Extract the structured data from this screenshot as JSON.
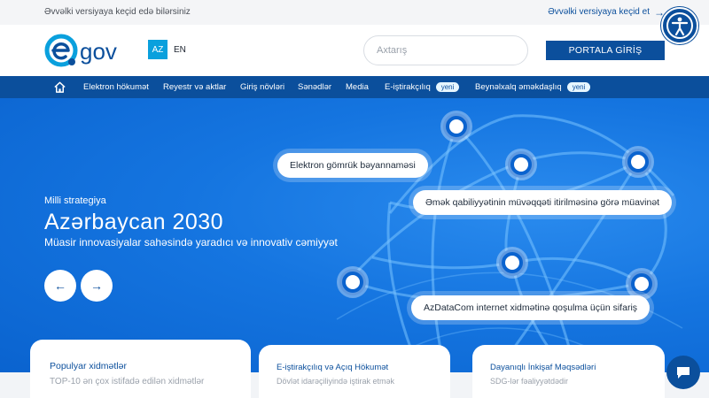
{
  "topbar": {
    "message": "Əvvəlki versiyaya keçid edə bilərsiniz",
    "old_version_link": "Əvvəlki versiyaya keçid et",
    "arrow_icon": "arrow-right-icon"
  },
  "header": {
    "logo_text": "gov",
    "lang_active": "AZ",
    "lang_other": "EN",
    "search_placeholder": "Axtarış",
    "portal_button": "PORTALA GİRİŞ",
    "accessibility_icon": "accessibility-icon"
  },
  "nav": {
    "home_icon": "home-icon",
    "items": [
      {
        "label": "Elektron hökumət"
      },
      {
        "label": "Reyestr və aktlar"
      },
      {
        "label": "Giriş növləri"
      },
      {
        "label": "Sənədlər"
      },
      {
        "label": "Media"
      },
      {
        "label": "E-iştirakçılıq",
        "badge": "yeni"
      },
      {
        "label": "Beynəlxalq əməkdaşlıq",
        "badge": "yeni"
      }
    ]
  },
  "hero": {
    "kicker": "Milli strategiya",
    "title": "Azərbaycan 2030",
    "subtitle": "Müasir innovasiyalar sahəsində yaradıcı və innovativ cəmiyyət",
    "prev_icon": "arrow-left-icon",
    "next_icon": "arrow-right-icon",
    "pills": [
      "Elektron gömrük bəyannaməsi",
      "Əmək qabiliyyətinin müvəqqəti itirilməsinə görə müavinət",
      "AzDataCom internet xidmətinə qoşulma üçün sifariş"
    ]
  },
  "cards": [
    {
      "title": "Populyar xidmətlər",
      "subtitle": "TOP-10 ən çox istifadə edilən xidmətlər"
    },
    {
      "title": "E-iştirakçılıq və Açıq Hökumət",
      "subtitle": "Dövlət idarəçiliyində iştirak etmək"
    },
    {
      "title": "Dayanıqlı İnkişaf Məqsədləri",
      "subtitle": "SDG-lər fəaliyyətdədir"
    }
  ],
  "chat_icon": "chat-bubble-icon",
  "colors": {
    "brand": "#0b4f9c",
    "accent": "#0aa0dd",
    "hero": "#1575e0"
  }
}
